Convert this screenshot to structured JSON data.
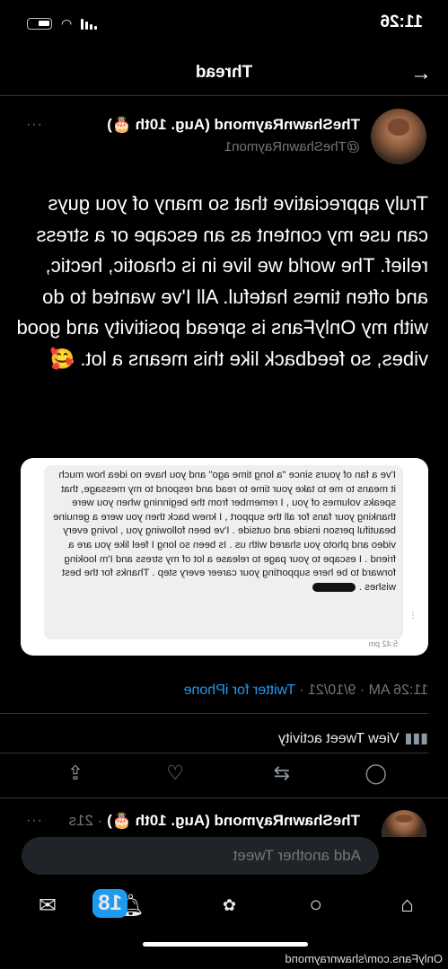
{
  "status_bar": {
    "time": "11:26"
  },
  "header": {
    "title": "Thread"
  },
  "tweet": {
    "author_name": "TheShawnRaymond (Aug. 10th 🎂)",
    "author_handle": "@TheShawnRaymon1",
    "text": "Truly appreciative that so many of you guys can use my content as an escape or a stress relief. The world we live in is chaotic, hectic, and often times hateful. All I've wanted to do with my OnlyFans is spread positivity and good vibes, so feedback like this means a lot. 🥰",
    "image_message": "I've a fan of yours since \"a long time ago\" and you have no idea how much it means to me to take your time to read and respond to my message, that speaks volumes of you , I remember from the beginning when you were thanking your fans for all the support , I knew back then you were a genuine beautiful person inside and outside . I've been following you , loving every video and photo you shared with us . Is been so long I feel like you are a friend . I escape to your page to release a lot of my stress and I'm looking forward to be here supporting your career every step . Thanks for the best wishes .",
    "image_timestamp": "5:42 pm",
    "time": "11:26 AM · 9/10/21 · ",
    "source": "Twitter for iPhone",
    "activity_label": "View Tweet activity"
  },
  "next_tweet": {
    "author_name": "TheShawnRaymond (Aug. 10th 🎂)",
    "age": " · 21s"
  },
  "reply": {
    "placeholder": "Add another Tweet"
  },
  "nav": {
    "notifications_badge": "18"
  },
  "watermark": "OnlyFans.com/shawnraymond"
}
